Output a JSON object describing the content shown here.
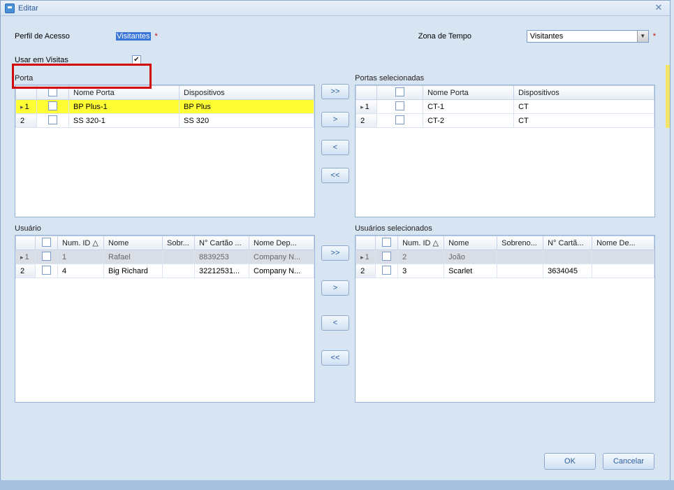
{
  "window": {
    "title": "Editar"
  },
  "form": {
    "perfil_label": "Perfil de Acesso",
    "perfil_value": "Visitantes",
    "zona_label": "Zona de Tempo",
    "zona_value": "Visitantes",
    "usar_label": "Usar em Visitas",
    "usar_checked": "✔"
  },
  "porta": {
    "section_left": "Porta",
    "section_right": "Portas selecionadas",
    "cols": {
      "nome": "Nome Porta",
      "disp": "Dispositivos"
    },
    "left_rows": [
      {
        "idx": "1",
        "nome": "BP Plus-1",
        "disp": "BP Plus",
        "sel": true
      },
      {
        "idx": "2",
        "nome": "SS 320-1",
        "disp": "SS 320",
        "sel": false
      }
    ],
    "right_rows": [
      {
        "idx": "1",
        "nome": "CT-1",
        "disp": "CT"
      },
      {
        "idx": "2",
        "nome": "CT-2",
        "disp": "CT"
      }
    ]
  },
  "usuario": {
    "section_left": "Usuário",
    "section_right": "Usuários selecionados",
    "cols": {
      "numid": "Num. ID",
      "nome": "Nome",
      "sobr": "Sobr...",
      "cart": "N° Cartão ...",
      "dep": "Nome Dep..."
    },
    "cols_r": {
      "numid": "Num. ID",
      "nome": "Nome",
      "sobr": "Sobreno...",
      "cart": "N° Cartã...",
      "dep": "Nome De..."
    },
    "left_rows": [
      {
        "idx": "1",
        "numid": "1",
        "nome": "Rafael",
        "sobr": "",
        "cart": "8839253",
        "dep": "Company N...",
        "sel": true
      },
      {
        "idx": "2",
        "numid": "4",
        "nome": "Big Richard",
        "sobr": "",
        "cart": "32212531...",
        "dep": "Company N...",
        "sel": false
      }
    ],
    "right_rows": [
      {
        "idx": "1",
        "numid": "2",
        "nome": "João",
        "sobr": "",
        "cart": "",
        "dep": "",
        "sel": true
      },
      {
        "idx": "2",
        "numid": "3",
        "nome": "Scarlet",
        "sobr": "",
        "cart": "3634045",
        "dep": "",
        "sel": false
      }
    ]
  },
  "transfer": {
    "all_right": ">>",
    "one_right": ">",
    "one_left": "<",
    "all_left": "<<"
  },
  "footer": {
    "ok": "OK",
    "cancel": "Cancelar"
  },
  "sort_indicator": "△"
}
